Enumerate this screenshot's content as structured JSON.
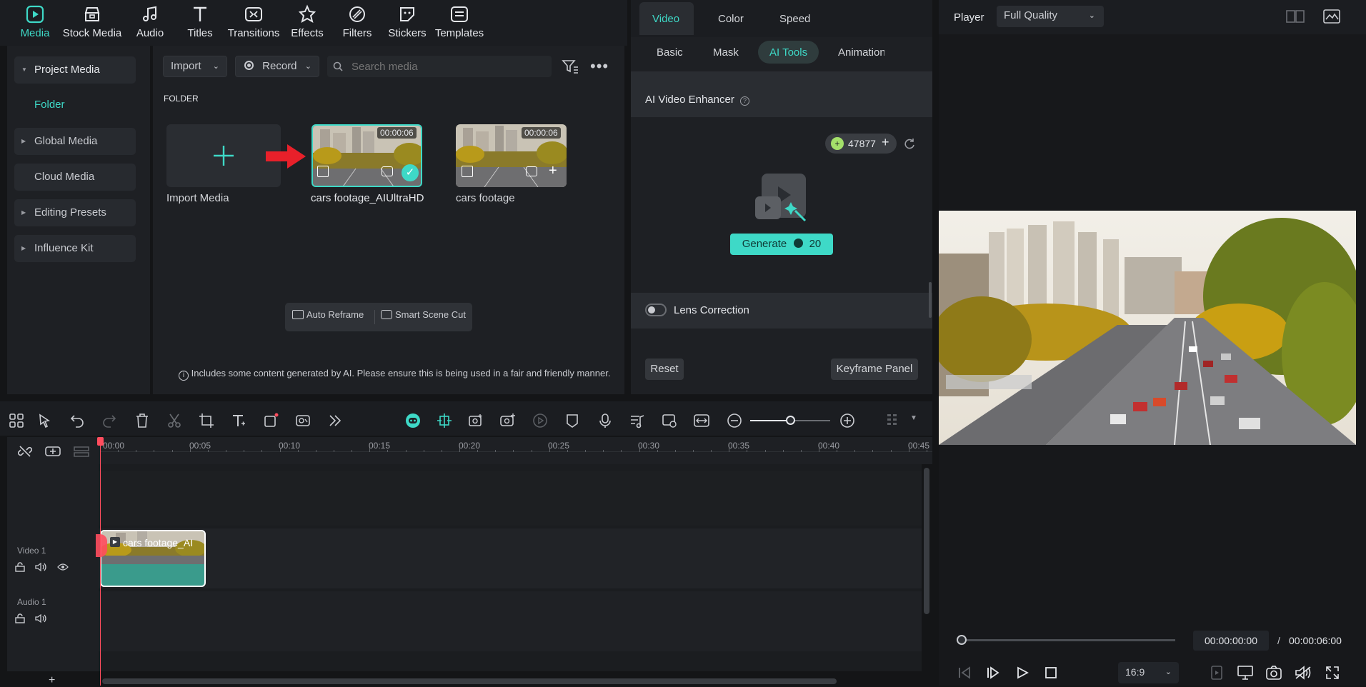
{
  "toolbar": {
    "items": [
      {
        "label": "Media",
        "icon": "media-icon"
      },
      {
        "label": "Stock Media",
        "icon": "stock-media-icon"
      },
      {
        "label": "Audio",
        "icon": "audio-icon"
      },
      {
        "label": "Titles",
        "icon": "titles-icon"
      },
      {
        "label": "Transitions",
        "icon": "transitions-icon"
      },
      {
        "label": "Effects",
        "icon": "effects-icon"
      },
      {
        "label": "Filters",
        "icon": "filters-icon"
      },
      {
        "label": "Stickers",
        "icon": "stickers-icon"
      },
      {
        "label": "Templates",
        "icon": "templates-icon"
      }
    ],
    "active": "Media"
  },
  "sidebar": {
    "items": [
      {
        "label": "Project Media"
      },
      {
        "label": "Folder"
      },
      {
        "label": "Global Media"
      },
      {
        "label": "Cloud Media"
      },
      {
        "label": "Editing Presets"
      },
      {
        "label": "Influence Kit"
      }
    ]
  },
  "media": {
    "import_label": "Import",
    "record_label": "Record",
    "search_placeholder": "Search media",
    "folder_heading": "FOLDER",
    "import_media_label": "Import Media",
    "items": [
      {
        "name": "cars footage_AIUltraHD",
        "duration": "00:00:06"
      },
      {
        "name": "cars footage",
        "duration": "00:00:06"
      }
    ],
    "auto_reframe": "Auto Reframe",
    "smart_scene_cut": "Smart Scene Cut",
    "disclaimer": "Includes some content generated by AI. Please ensure this is being used in a fair and friendly manner."
  },
  "properties": {
    "tabs": [
      "Video",
      "Color",
      "Speed"
    ],
    "subtabs": [
      "Basic",
      "Mask",
      "AI Tools",
      "Animation"
    ],
    "section_title": "AI Video Enhancer",
    "credits": "47877",
    "generate_label": "Generate",
    "generate_cost": "20",
    "lens_correction": "Lens Correction",
    "reset_label": "Reset",
    "keyframe_label": "Keyframe Panel"
  },
  "player": {
    "label": "Player",
    "quality": "Full Quality",
    "current_time": "00:00:00:00",
    "separator": "/",
    "total_time": "00:00:06:00",
    "aspect": "16:9",
    "progress": 0
  },
  "timeline": {
    "ticks": [
      "00:00",
      "00:05",
      "00:10",
      "00:15",
      "00:20",
      "00:25",
      "00:30",
      "00:35",
      "00:40",
      "00:45"
    ],
    "tracks": [
      {
        "label": "Video 1"
      },
      {
        "label": "Audio 1"
      }
    ],
    "clip_label": "cars footage_AI",
    "add_track": "+"
  },
  "colors": {
    "accent": "#3ed9c7",
    "playhead": "#ff4d5e",
    "arrow": "#e8202a"
  }
}
